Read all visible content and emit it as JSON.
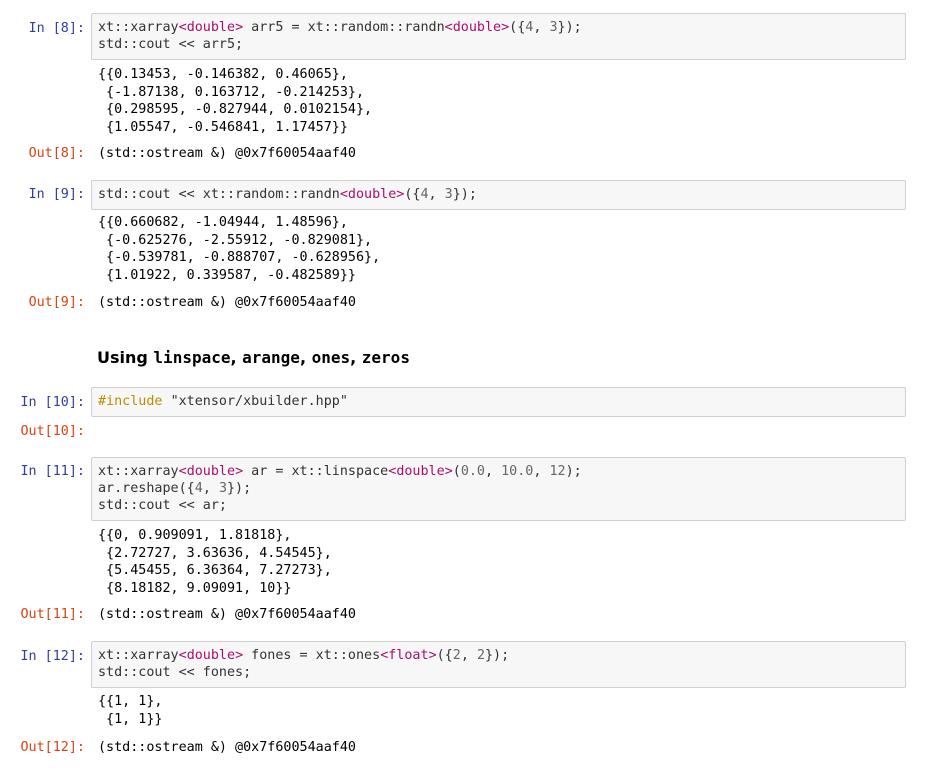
{
  "cells": [
    {
      "in_prompt": "In [8]:",
      "code": [
        [
          [
            "ns",
            "xt::xarray"
          ],
          [
            "tmpl",
            "<"
          ],
          [
            "kw",
            "double"
          ],
          [
            "tmpl",
            ">"
          ],
          [
            "ns",
            " arr5 = xt::random::randn"
          ],
          [
            "tmpl",
            "<"
          ],
          [
            "kw",
            "double"
          ],
          [
            "tmpl",
            ">"
          ],
          [
            "ns",
            "({"
          ],
          [
            "num",
            "4"
          ],
          [
            "ns",
            ", "
          ],
          [
            "num",
            "3"
          ],
          [
            "ns",
            "});"
          ]
        ],
        [
          [
            "ns",
            "std::cout << arr5;"
          ]
        ]
      ],
      "stdout": [
        "{{0.13453, -0.146382, 0.46065},",
        " {-1.87138, 0.163712, -0.214253},",
        " {0.298595, -0.827944, 0.0102154},",
        " {1.05547, -0.546841, 1.17457}}"
      ],
      "out_prompt": "Out[8]:",
      "out_value": "(std::ostream &) @0x7f60054aaf40"
    },
    {
      "in_prompt": "In [9]:",
      "code": [
        [
          [
            "ns",
            "std::cout << xt::random::randn"
          ],
          [
            "tmpl",
            "<"
          ],
          [
            "kw",
            "double"
          ],
          [
            "tmpl",
            ">"
          ],
          [
            "ns",
            "({"
          ],
          [
            "num",
            "4"
          ],
          [
            "ns",
            ", "
          ],
          [
            "num",
            "3"
          ],
          [
            "ns",
            "});"
          ]
        ]
      ],
      "stdout": [
        "{{0.660682, -1.04944, 1.48596},",
        " {-0.625276, -2.55912, -0.829081},",
        " {-0.539781, -0.888707, -0.628956},",
        " {1.01922, 0.339587, -0.482589}}"
      ],
      "out_prompt": "Out[9]:",
      "out_value": "(std::ostream &) @0x7f60054aaf40"
    },
    {
      "heading_parts": [
        [
          "text",
          "Using "
        ],
        [
          "code",
          "linspace"
        ],
        [
          "text",
          ", "
        ],
        [
          "code",
          "arange"
        ],
        [
          "text",
          ", "
        ],
        [
          "code",
          "ones"
        ],
        [
          "text",
          ", "
        ],
        [
          "code",
          "zeros"
        ]
      ]
    },
    {
      "in_prompt": "In [10]:",
      "code": [
        [
          [
            "include",
            "#include"
          ],
          [
            "ns",
            " "
          ],
          [
            "str",
            "\"xtensor/xbuilder.hpp\""
          ]
        ]
      ],
      "stdout": [],
      "out_prompt": "Out[10]:",
      "out_value": ""
    },
    {
      "in_prompt": "In [11]:",
      "code": [
        [
          [
            "ns",
            "xt::xarray"
          ],
          [
            "tmpl",
            "<"
          ],
          [
            "kw",
            "double"
          ],
          [
            "tmpl",
            ">"
          ],
          [
            "ns",
            " ar = xt::linspace"
          ],
          [
            "tmpl",
            "<"
          ],
          [
            "kw",
            "double"
          ],
          [
            "tmpl",
            ">"
          ],
          [
            "ns",
            "("
          ],
          [
            "num",
            "0.0"
          ],
          [
            "ns",
            ", "
          ],
          [
            "num",
            "10.0"
          ],
          [
            "ns",
            ", "
          ],
          [
            "num",
            "12"
          ],
          [
            "ns",
            ");"
          ]
        ],
        [
          [
            "ns",
            "ar.reshape({"
          ],
          [
            "num",
            "4"
          ],
          [
            "ns",
            ", "
          ],
          [
            "num",
            "3"
          ],
          [
            "ns",
            "});"
          ]
        ],
        [
          [
            "ns",
            "std::cout << ar;"
          ]
        ]
      ],
      "stdout": [
        "{{0, 0.909091, 1.81818},",
        " {2.72727, 3.63636, 4.54545},",
        " {5.45455, 6.36364, 7.27273},",
        " {8.18182, 9.09091, 10}}"
      ],
      "out_prompt": "Out[11]:",
      "out_value": "(std::ostream &) @0x7f60054aaf40"
    },
    {
      "in_prompt": "In [12]:",
      "code": [
        [
          [
            "ns",
            "xt::xarray"
          ],
          [
            "tmpl",
            "<"
          ],
          [
            "kw",
            "double"
          ],
          [
            "tmpl",
            ">"
          ],
          [
            "ns",
            " fones = xt::ones"
          ],
          [
            "tmpl",
            "<"
          ],
          [
            "kw",
            "float"
          ],
          [
            "tmpl",
            ">"
          ],
          [
            "ns",
            "({"
          ],
          [
            "num",
            "2"
          ],
          [
            "ns",
            ", "
          ],
          [
            "num",
            "2"
          ],
          [
            "ns",
            "});"
          ]
        ],
        [
          [
            "ns",
            "std::cout << fones;"
          ]
        ]
      ],
      "stdout": [
        "{{1, 1},",
        " {1, 1}}"
      ],
      "out_prompt": "Out[12]:",
      "out_value": "(std::ostream &) @0x7f60054aaf40"
    }
  ],
  "colors": {
    "in_prompt": "#303f9f",
    "out_prompt": "#d84315",
    "code_bg": "#f7f7f7",
    "code_border": "#cfcfcf",
    "type_keyword": "#aa22ff",
    "template_bracket": "#aa0d6d",
    "number": "#666666",
    "include": "#ba8d00",
    "string": "#ba2121"
  }
}
